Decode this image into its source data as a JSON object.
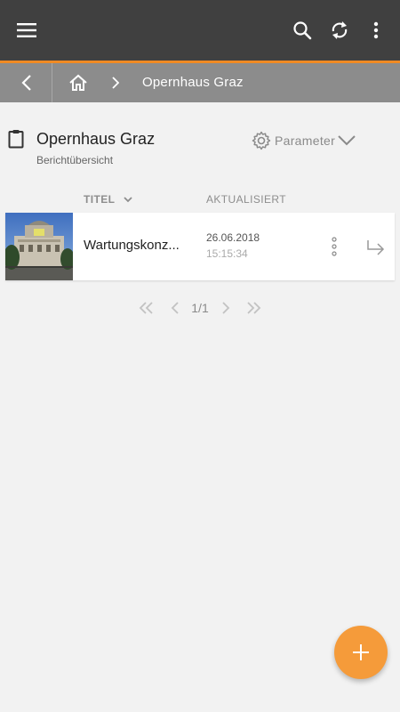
{
  "topbar": {
    "icons": [
      "menu-icon",
      "search-icon",
      "sync-icon",
      "more-vert-icon"
    ],
    "accent_color": "#f08a24",
    "background": "#404040"
  },
  "breadcrumb": {
    "icons": [
      "back-arrow-icon",
      "home-icon",
      "chevron-right-icon"
    ],
    "current": "Opernhaus Graz"
  },
  "header": {
    "icon": "clipboard-icon",
    "title": "Opernhaus Graz",
    "subtitle": "Berichtübersicht",
    "parameter_label": "Parameter"
  },
  "table": {
    "columns": {
      "title": "TITEL",
      "updated": "AKTUALISIERT"
    },
    "rows": [
      {
        "title": "Wartungskonz...",
        "date": "26.06.2018",
        "time": "15:15:34",
        "thumbnail": "opera-house-photo"
      }
    ]
  },
  "pagination": {
    "label": "1/1"
  },
  "fab": {
    "icon": "plus-icon",
    "color": "#f59b3a"
  }
}
